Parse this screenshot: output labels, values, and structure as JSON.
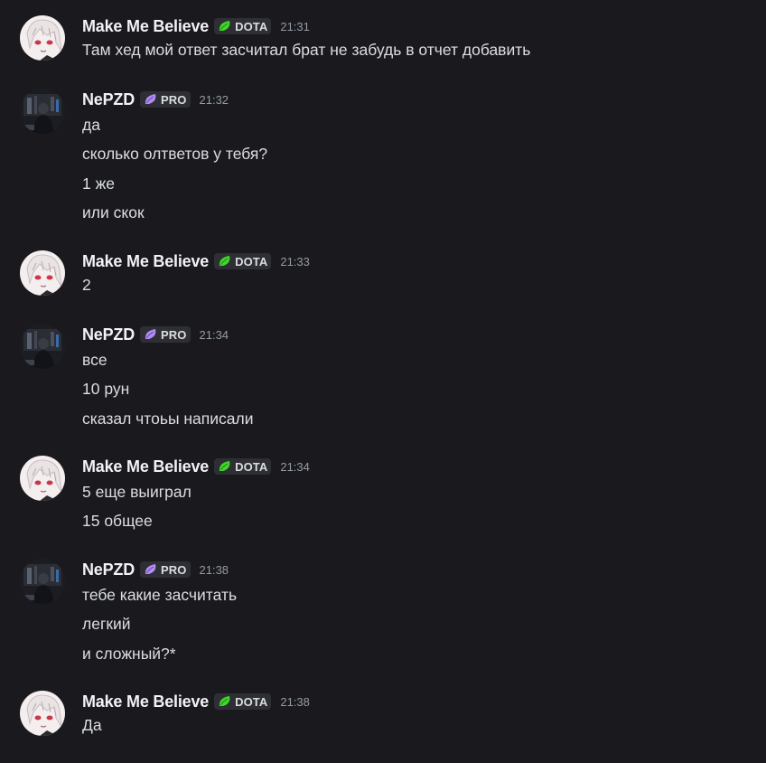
{
  "colors": {
    "background": "#1a1a1e",
    "username": "#f2f3f5",
    "message_text": "#dbdee1",
    "timestamp": "#949ba4",
    "tag_background": "#2e2f34",
    "dota_leaf": "#3fd82a",
    "pro_leaf": "#b38cf2"
  },
  "users": {
    "mmb": {
      "name": "Make Me Believe",
      "tag": "DOTA",
      "tag_icon": "green-leaf-icon"
    },
    "nepzd": {
      "name": "NePZD",
      "tag": "PRO",
      "tag_icon": "purple-leaf-icon"
    }
  },
  "messages": [
    {
      "author": "Make Me Believe",
      "tag": "DOTA",
      "time": "21:31",
      "lines": [
        "Там хед мой ответ засчитал брат не забудь в отчет добавить"
      ]
    },
    {
      "author": "NePZD",
      "tag": "PRO",
      "time": "21:32",
      "lines": [
        "да",
        "сколько олтветов у тебя?",
        "1 же",
        "или скок"
      ]
    },
    {
      "author": "Make Me Believe",
      "tag": "DOTA",
      "time": "21:33",
      "lines": [
        "2"
      ]
    },
    {
      "author": "NePZD",
      "tag": "PRO",
      "time": "21:34",
      "lines": [
        "все",
        "10 рун",
        "сказал чтоьы написали"
      ]
    },
    {
      "author": "Make Me Believe",
      "tag": "DOTA",
      "time": "21:34",
      "lines": [
        "5 еще выиграл",
        "15 общее"
      ]
    },
    {
      "author": "NePZD",
      "tag": "PRO",
      "time": "21:38",
      "lines": [
        "тебе какие засчитать",
        "легкий",
        "и сложный?*"
      ]
    },
    {
      "author": "Make Me Believe",
      "tag": "DOTA",
      "time": "21:38",
      "lines": [
        "Да"
      ]
    }
  ]
}
